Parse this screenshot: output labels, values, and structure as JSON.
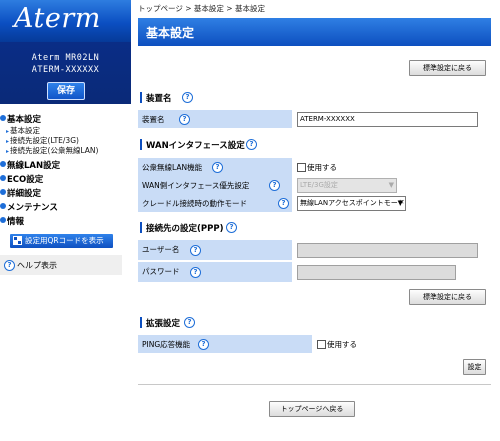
{
  "brand": {
    "logo": "Aterm",
    "model_line1": "Aterm MR02LN",
    "model_line2": "ATERM-XXXXXX",
    "save_label": "保存"
  },
  "sidebar": {
    "sections": [
      {
        "label": "基本設定",
        "items": [
          "基本設定",
          "接続先設定(LTE/3G)",
          "接続先設定(公衆無線LAN)"
        ]
      },
      {
        "label": "無線LAN設定",
        "items": []
      },
      {
        "label": "ECO設定",
        "items": []
      },
      {
        "label": "詳細設定",
        "items": []
      },
      {
        "label": "メンテナンス",
        "items": []
      },
      {
        "label": "情報",
        "items": []
      }
    ],
    "qr_button": "設定用QRコードを表示",
    "help": "ヘルプ表示"
  },
  "main": {
    "breadcrumb": "トップページ > 基本設定 > 基本設定",
    "title": "基本設定",
    "reset_label": "標準設定に戻る",
    "device_section": {
      "label": "装置名",
      "field_label": "装置名",
      "value": "ATERM-XXXXXX"
    },
    "wan_section": {
      "label": "WANインタフェース設定",
      "public_lan_label": "公衆無線LAN機能",
      "public_lan_option": "使用する",
      "priority_label": "WAN側インタフェース優先設定",
      "priority_value": "LTE/3G設定",
      "cradle_label": "クレードル接続時の動作モード",
      "cradle_value": "無線LANアクセスポイントモード"
    },
    "ppp_section": {
      "label": "接続先の設定(PPP)",
      "user_label": "ユーザー名",
      "password_label": "パスワード",
      "reset_label": "標準設定に戻る"
    },
    "ext_section": {
      "label": "拡張設定",
      "ping_label": "PING応答機能",
      "ping_option": "使用する"
    },
    "set_label": "設定",
    "back_label": "トップページへ戻る"
  },
  "colors": {
    "accent": "#0d4fbf",
    "label_bg": "#c9dcf6",
    "dark_blue": "#0a2d86"
  }
}
